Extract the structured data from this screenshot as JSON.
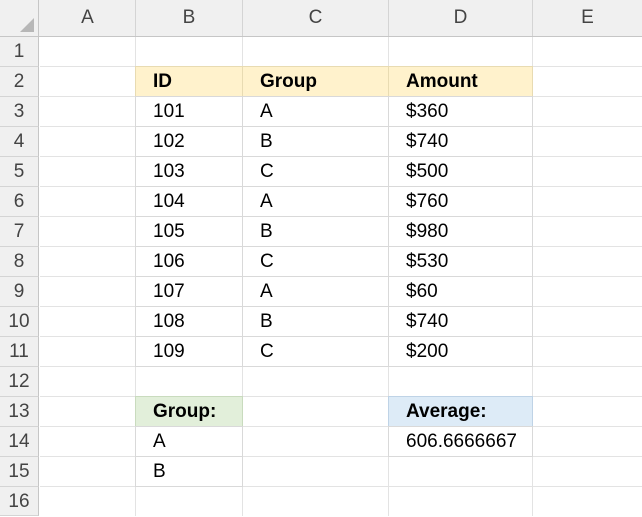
{
  "columns": [
    "A",
    "B",
    "C",
    "D",
    "E"
  ],
  "rows": [
    "1",
    "2",
    "3",
    "4",
    "5",
    "6",
    "7",
    "8",
    "9",
    "10",
    "11",
    "12",
    "13",
    "14",
    "15",
    "16"
  ],
  "table": {
    "headers": [
      "ID",
      "Group",
      "Amount"
    ],
    "rows": [
      [
        "101",
        "A",
        "$360"
      ],
      [
        "102",
        "B",
        "$740"
      ],
      [
        "103",
        "C",
        "$500"
      ],
      [
        "104",
        "A",
        "$760"
      ],
      [
        "105",
        "B",
        "$980"
      ],
      [
        "106",
        "C",
        "$530"
      ],
      [
        "107",
        "A",
        "$60"
      ],
      [
        "108",
        "B",
        "$740"
      ],
      [
        "109",
        "C",
        "$200"
      ]
    ]
  },
  "criteria": {
    "header": "Group:",
    "values": [
      "A",
      "B"
    ]
  },
  "result": {
    "header": "Average:",
    "value": "606.6666667"
  },
  "colors": {
    "table_header_fill": "#fff2cc",
    "criteria_header_fill": "#e2efda",
    "result_header_fill": "#ddebf7"
  }
}
